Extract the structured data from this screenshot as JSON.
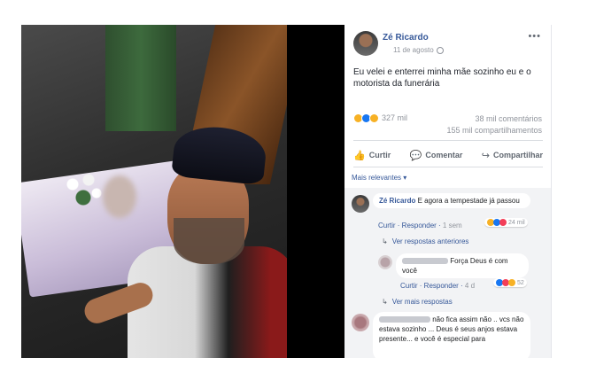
{
  "post": {
    "author": "Zé Ricardo",
    "date": "11 de agosto",
    "more_label": "•••",
    "text": "Eu velei e enterrei minha mãe sozinho eu e o motorista da funerária",
    "reaction_count": "327 mil",
    "comments_count": "38 mil comentários",
    "shares_count": "155 mil compartilhamentos",
    "reaction_icons": [
      "sad-icon",
      "like-icon",
      "wow-icon"
    ]
  },
  "actions": {
    "like_label": "Curtir",
    "comment_label": "Comentar",
    "share_label": "Compartilhar"
  },
  "filter_label": "Mais relevantes ▾",
  "comments": [
    {
      "author": "Zé Ricardo",
      "text": "E agora a tempestade já passou",
      "like": "Curtir",
      "reply": "Responder",
      "time": "1 sem",
      "reactions": "24 mil",
      "view_previous": "Ver respostas anteriores"
    },
    {
      "text": "Força Deus é com você",
      "like": "Curtir",
      "reply": "Responder",
      "time": "4 d",
      "reactions": "52",
      "view_more": "Ver mais respostas"
    },
    {
      "text": "não fica assim não .. vcs não estava sozinho ... Deus é seus anjos estava presente... e você é especial para"
    }
  ],
  "colors": {
    "link": "#365899",
    "muted": "#90949c",
    "comment_bg": "#f2f3f5"
  }
}
